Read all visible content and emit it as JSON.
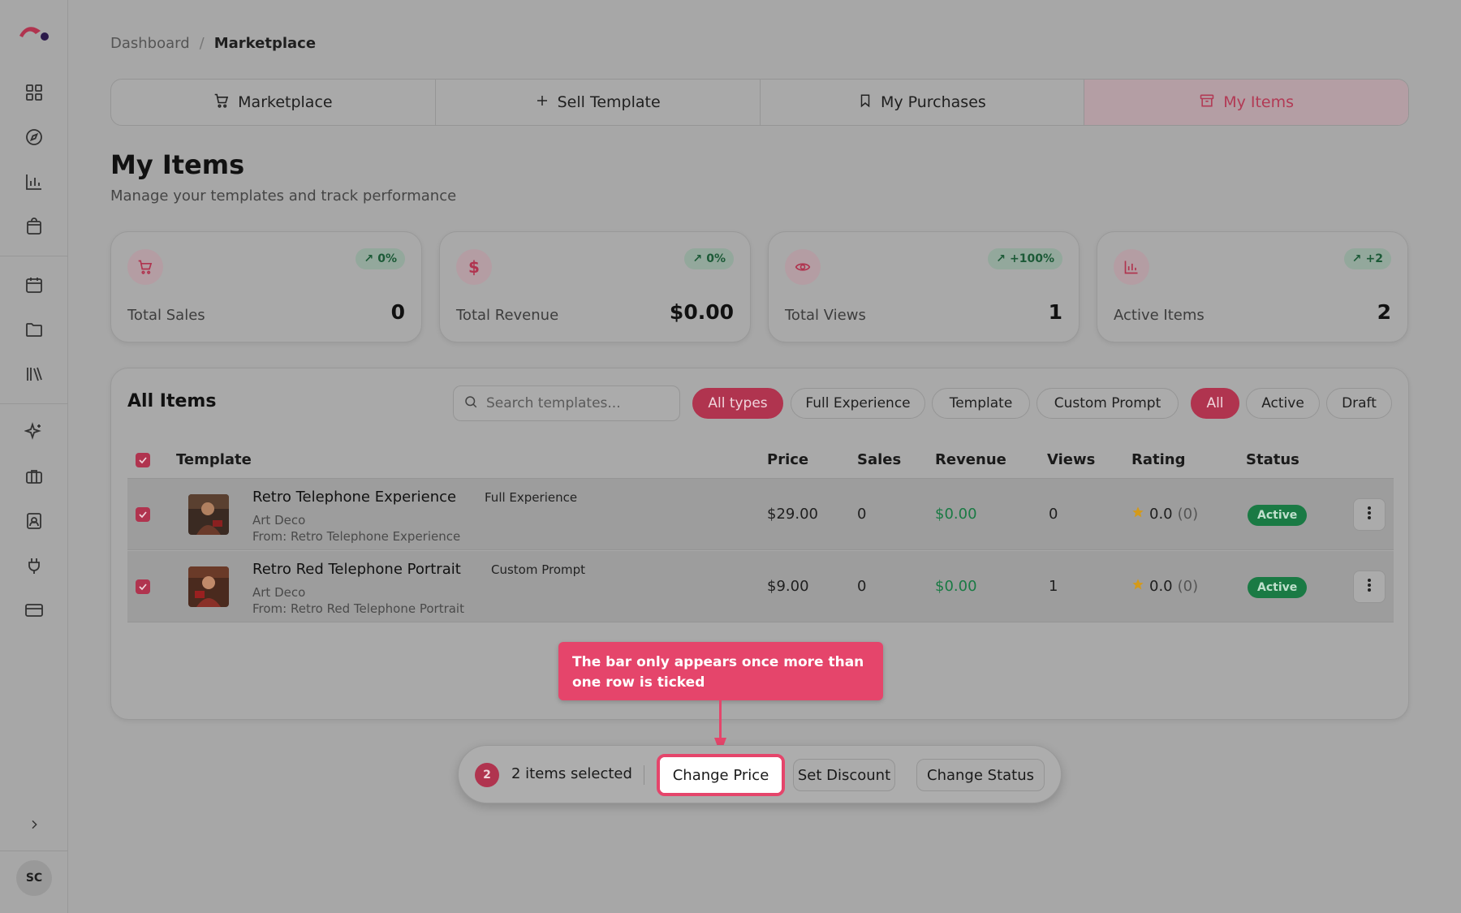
{
  "breadcrumb": {
    "home": "Dashboard",
    "separator": "/",
    "current": "Marketplace"
  },
  "tabs": [
    {
      "label": "Marketplace",
      "icon": "cart-icon"
    },
    {
      "label": "Sell Template",
      "icon": "plus-icon"
    },
    {
      "label": "My Purchases",
      "icon": "bookmark-icon"
    },
    {
      "label": "My Items",
      "icon": "archive-icon",
      "active": true
    }
  ],
  "page": {
    "title": "My Items",
    "subtitle": "Manage your templates and track performance"
  },
  "stats": [
    {
      "label": "Total Sales",
      "value": "0",
      "badge": "0%",
      "icon": "cart-icon"
    },
    {
      "label": "Total Revenue",
      "value": "$0.00",
      "badge": "0%",
      "icon": "dollar-icon"
    },
    {
      "label": "Total Views",
      "value": "1",
      "badge": "+100%",
      "icon": "eye-icon"
    },
    {
      "label": "Active Items",
      "value": "2",
      "badge": "+2",
      "icon": "bar-chart-icon"
    }
  ],
  "items": {
    "title": "All Items",
    "search_placeholder": "Search templates...",
    "type_filters": [
      "All types",
      "Full Experience",
      "Template",
      "Custom Prompt"
    ],
    "status_filters": [
      "All",
      "Active",
      "Draft"
    ],
    "columns": [
      "Template",
      "Price",
      "Sales",
      "Revenue",
      "Views",
      "Rating",
      "Status"
    ],
    "rows": [
      {
        "name": "Retro Telephone Experience",
        "type": "Full Experience",
        "style": "Art Deco",
        "from": "From: Retro Telephone Experience",
        "price": "$29.00",
        "sales": "0",
        "revenue": "$0.00",
        "views": "0",
        "rating": "0.0",
        "rating_count": "(0)",
        "status": "Active"
      },
      {
        "name": "Retro Red Telephone Portrait",
        "type": "Custom Prompt",
        "style": "Art Deco",
        "from": "From: Retro Red Telephone Portrait",
        "price": "$9.00",
        "sales": "0",
        "revenue": "$0.00",
        "views": "1",
        "rating": "0.0",
        "rating_count": "(0)",
        "status": "Active"
      }
    ]
  },
  "tooltip": {
    "text": "The bar only appears once more than one row is ticked"
  },
  "bulk_bar": {
    "count": "2",
    "label": "2 items selected",
    "actions": [
      "Change Price",
      "Set Discount",
      "Change Status"
    ]
  },
  "user": {
    "initials": "SC"
  },
  "colors": {
    "accent": "#b0344f",
    "tooltip": "#e5456b",
    "success": "#1a7a44"
  }
}
